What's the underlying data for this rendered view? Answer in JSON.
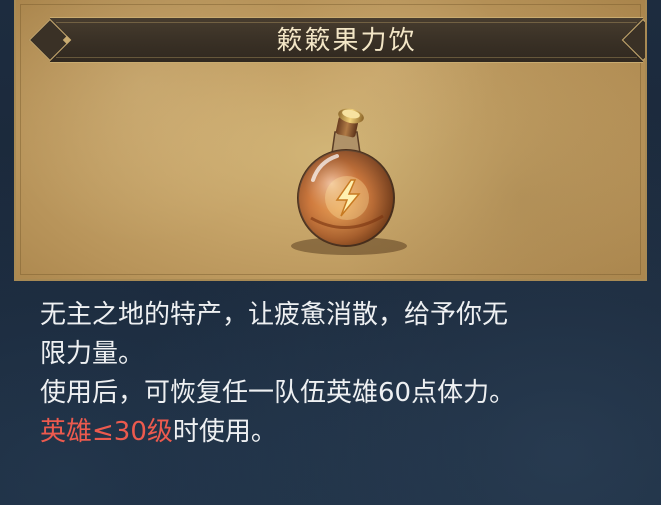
{
  "item": {
    "title": "簌簌果力饮",
    "icon": "lightning-potion-icon",
    "description_line1": "无主之地的特产，让疲惫消散，给予你无",
    "description_line2": "限力量。",
    "effect": "使用后，可恢复任一队伍英雄60点体力。",
    "requirement_highlight": "英雄≤30级",
    "requirement_suffix": "时使用。"
  },
  "colors": {
    "requirement": "#ec5a4e",
    "text": "#eef0f2",
    "title": "#f3e6c6"
  }
}
